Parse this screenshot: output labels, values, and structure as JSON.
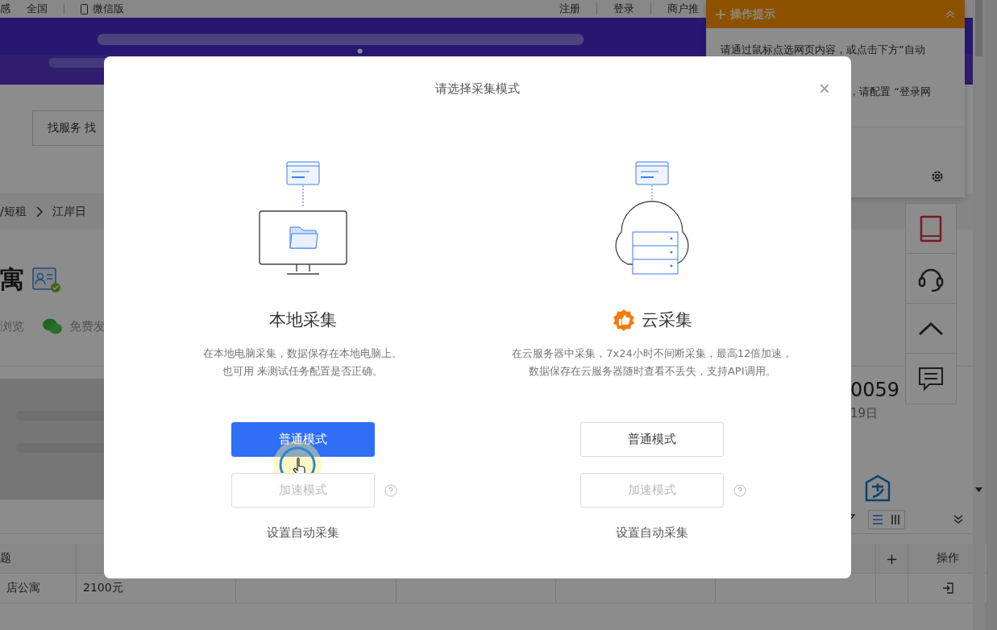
{
  "top_bar": {
    "left": [
      "感",
      "全国",
      "微信版"
    ],
    "right": [
      "注册",
      "登录",
      "商户推"
    ]
  },
  "banner": {
    "kind": "picture"
  },
  "search_box": {
    "value": "找服务 找"
  },
  "breadcrumb": [
    "/短租",
    "江岸日"
  ],
  "listing": {
    "title": "寓",
    "stats": [
      "浏览",
      "免费发"
    ],
    "phone": "0059",
    "date": "19日",
    "photo": {
      "kind": "picture"
    }
  },
  "hint_panel": {
    "title": "操作提示",
    "expanded": true,
    "lines": [
      "请通过鼠标点选网页内容，或点击下方”自动",
      "，请配置 “登录网"
    ]
  },
  "table": {
    "header": [
      "题"
    ],
    "add_column": "+",
    "action_header": "操作",
    "rows": [
      {
        "cells": [
          "店公寓",
          "2100元"
        ]
      }
    ]
  },
  "dialog": {
    "title": "请选择采集模式",
    "close": "×",
    "options": [
      {
        "kind": "local",
        "title": "本地采集",
        "description": [
          "在本地电脑采集，数据保存在本地电脑上。",
          "也可用 来测试任务配置是否正确。"
        ],
        "buttons": [
          {
            "label": "普通模式",
            "primary": true,
            "disabled": false,
            "hovered": true
          },
          {
            "label": "加速模式",
            "primary": false,
            "disabled": true,
            "hovered": false
          }
        ],
        "link": "设置自动采集"
      },
      {
        "kind": "cloud",
        "title": "云采集",
        "description": [
          "在云服务器中采集，7x24小时不间断采集，最高12倍加速，",
          "数据保存在云服务器随时查看不丢失，支持API调用。"
        ],
        "buttons": [
          {
            "label": "普通模式",
            "primary": false,
            "disabled": false,
            "hovered": false
          },
          {
            "label": "加速模式",
            "primary": false,
            "disabled": true,
            "hovered": false
          }
        ],
        "link": "设置自动采集"
      }
    ]
  }
}
